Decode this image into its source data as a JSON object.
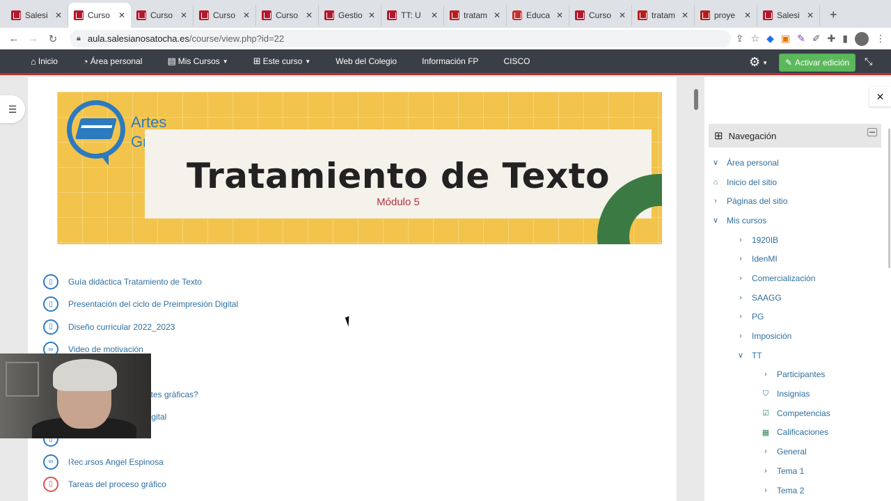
{
  "browser": {
    "tabs": [
      {
        "title": "Salesi",
        "icon": "school-favicon",
        "active": false
      },
      {
        "title": "Curso",
        "icon": "school-favicon",
        "active": true
      },
      {
        "title": "Curso",
        "icon": "school-favicon",
        "active": false
      },
      {
        "title": "Curso",
        "icon": "school-favicon",
        "active": false
      },
      {
        "title": "Curso",
        "icon": "school-favicon",
        "active": false
      },
      {
        "title": "Gestio",
        "icon": "school-favicon",
        "active": false
      },
      {
        "title": "TT: U",
        "icon": "school-favicon",
        "active": false
      },
      {
        "title": "tratam",
        "icon": "pdf-favicon",
        "active": false
      },
      {
        "title": "Educa",
        "icon": "youtube-favicon",
        "active": false
      },
      {
        "title": "Curso",
        "icon": "school-favicon",
        "active": false
      },
      {
        "title": "tratam",
        "icon": "pdf-favicon",
        "active": false
      },
      {
        "title": "proye",
        "icon": "pdf-favicon",
        "active": false
      },
      {
        "title": "Salesi",
        "icon": "school-favicon",
        "active": false
      }
    ],
    "url_domain": "aula.salesianosatocha.es",
    "url_path": "/course/view.php?id=22"
  },
  "navbar": {
    "home": "Inicio",
    "personal": "Área personal",
    "my_courses": "Mis Cursos",
    "this_course": "Este curso",
    "college_web": "Web del Colegio",
    "fp_info": "Información FP",
    "cisco": "CISCO",
    "edit_button": "Activar edición"
  },
  "banner": {
    "logo_line1": "Artes",
    "logo_line2": "Gráficas",
    "title": "Tratamiento de Texto",
    "subtitle": "Módulo 5"
  },
  "activities": [
    {
      "label": "Guía didáctica Tratamiento de Texto",
      "icon": "file-icon"
    },
    {
      "label": "Presentación del ciclo de Preimpresión Digital",
      "icon": "file-icon"
    },
    {
      "label": "Diseño curricular 2022_2023",
      "icon": "file-icon"
    },
    {
      "label": "Video de motivación",
      "icon": "link-icon"
    },
    {
      "label": "",
      "icon": "link-icon"
    },
    {
      "label": "artes gráficas?",
      "icon": "link-icon"
    },
    {
      "label": "Digital",
      "icon": "file-icon"
    },
    {
      "label": "",
      "icon": "file-icon"
    },
    {
      "label": "Recursos Angel Espinosa",
      "icon": "link-icon"
    },
    {
      "label": "Tareas del proceso gráfico",
      "icon": "pdf-icon"
    }
  ],
  "navigation": {
    "heading": "Navegación",
    "items": [
      {
        "label": "Área personal",
        "icon": "chevron-down"
      },
      {
        "label": "Inicio del sitio",
        "icon": "home"
      },
      {
        "label": "Páginas del sitio",
        "icon": "chevron-right"
      },
      {
        "label": "Mis cursos",
        "icon": "chevron-down"
      },
      {
        "label": "1920IB",
        "icon": "chevron-right"
      },
      {
        "label": "IdenMI",
        "icon": "chevron-right"
      },
      {
        "label": "Comercialización",
        "icon": "chevron-right"
      },
      {
        "label": "SAAGG",
        "icon": "chevron-right"
      },
      {
        "label": "PG",
        "icon": "chevron-right"
      },
      {
        "label": "Imposición",
        "icon": "chevron-right"
      },
      {
        "label": "TT",
        "icon": "chevron-down"
      },
      {
        "label": "Participantes",
        "icon": "chevron-right"
      },
      {
        "label": "Insignias",
        "icon": "shield"
      },
      {
        "label": "Competencias",
        "icon": "check-square"
      },
      {
        "label": "Calificaciones",
        "icon": "table"
      },
      {
        "label": "General",
        "icon": "chevron-right"
      },
      {
        "label": "Tema 1",
        "icon": "chevron-right"
      },
      {
        "label": "Tema 2",
        "icon": "chevron-right"
      }
    ]
  },
  "colors": {
    "navbar_bg": "#3a3f47",
    "navbar_accent": "#c42c2c",
    "edit_button": "#5cb85c",
    "banner_yellow": "#f3c44c",
    "link_blue": "#2f6f9f"
  }
}
